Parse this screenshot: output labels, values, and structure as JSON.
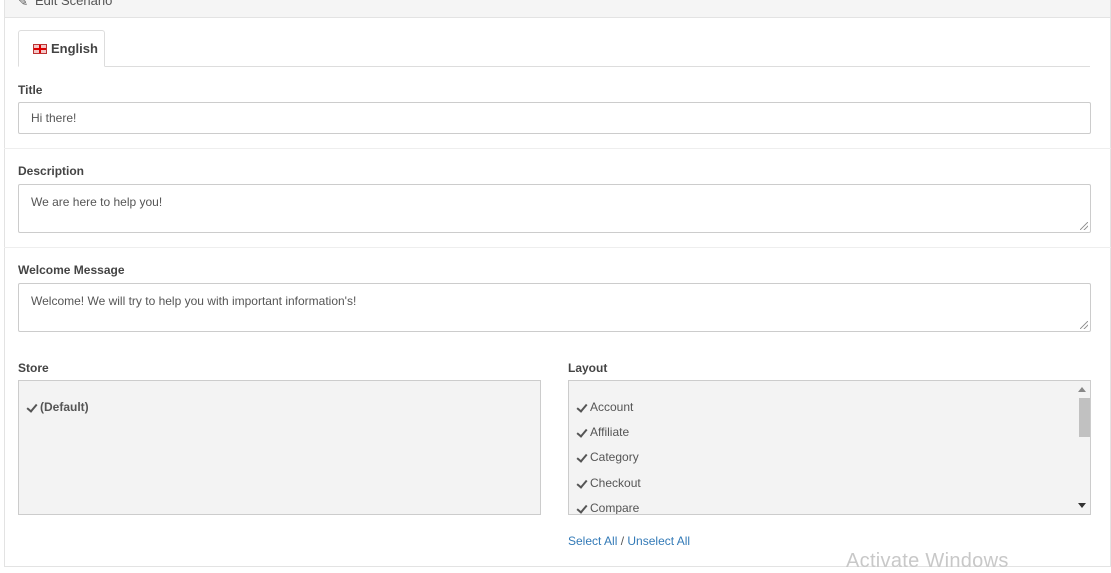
{
  "header": {
    "title": "Edit Scenario",
    "icon": "pencil-icon"
  },
  "tabs": [
    {
      "label": "English",
      "icon": "uk-flag-icon"
    }
  ],
  "form": {
    "title": {
      "label": "Title",
      "value": "Hi there!"
    },
    "description": {
      "label": "Description",
      "value": "We are here to help you!"
    },
    "welcome": {
      "label": "Welcome Message",
      "value": "Welcome! We will try to help you with important information's!"
    },
    "store": {
      "label": "Store",
      "items": [
        {
          "label": "(Default)",
          "checked": true
        }
      ]
    },
    "layout": {
      "label": "Layout",
      "items": [
        {
          "label": "Account",
          "checked": true
        },
        {
          "label": "Affiliate",
          "checked": true
        },
        {
          "label": "Category",
          "checked": true
        },
        {
          "label": "Checkout",
          "checked": true
        },
        {
          "label": "Compare",
          "checked": true
        }
      ],
      "select_all": "Select All",
      "separator": "/",
      "unselect_all": "Unselect All"
    }
  },
  "watermark": "Activate Windows"
}
